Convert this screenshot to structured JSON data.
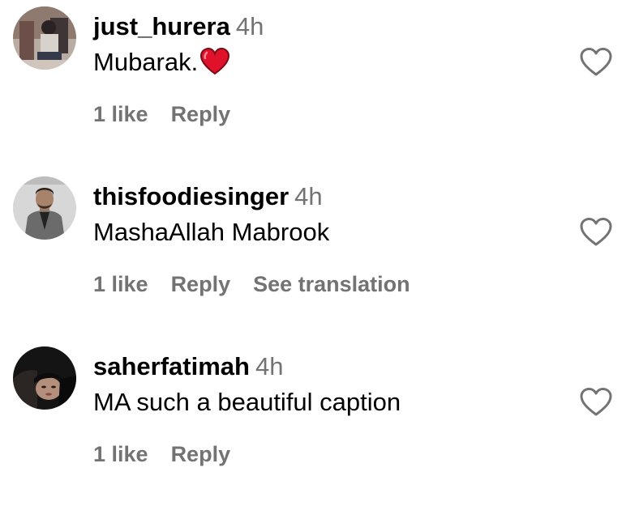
{
  "comments": [
    {
      "username": "just_hurera",
      "time": "4h",
      "text": "Mubarak.",
      "emoji": "red-heart",
      "likes": "1 like",
      "reply": "Reply",
      "translation": ""
    },
    {
      "username": "thisfoodiesinger",
      "time": "4h",
      "text": "MashaAllah Mabrook",
      "emoji": "",
      "likes": "1 like",
      "reply": "Reply",
      "translation": "See translation"
    },
    {
      "username": "saherfatimah",
      "time": "4h",
      "text": "MA such a beautiful caption",
      "emoji": "",
      "likes": "1 like",
      "reply": "Reply",
      "translation": ""
    }
  ],
  "colors": {
    "secondary_text": "#737373",
    "heart_emoji": "#e0112b",
    "like_icon_stroke": "#737373"
  },
  "icons": {
    "like": "heart-outline-icon",
    "emoji": "red-heart-emoji-icon"
  }
}
